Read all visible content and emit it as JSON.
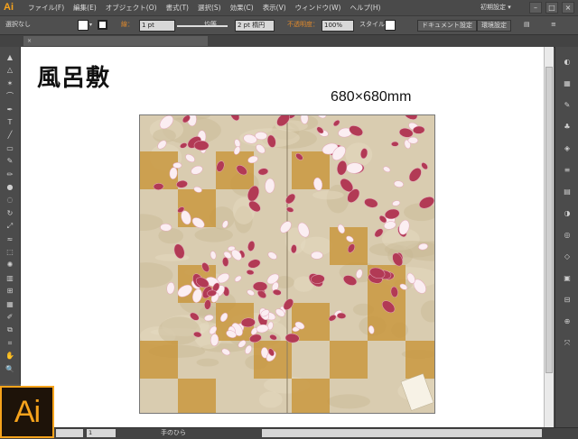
{
  "app": {
    "logo_text": "Ai",
    "workspace": "初期設定 ▾"
  },
  "menu": {
    "items": [
      "ファイル(F)",
      "編集(E)",
      "オブジェクト(O)",
      "書式(T)",
      "選択(S)",
      "効果(C)",
      "表示(V)",
      "ウィンドウ(W)",
      "ヘルプ(H)"
    ]
  },
  "control_bar": {
    "selection": "選択なし",
    "stroke_label": "線：",
    "stroke_weight": "1 pt",
    "stroke_profile": "均等",
    "brush": "2 pt 楕円",
    "opacity_label": "不透明度：",
    "opacity_value": "100%",
    "style_label": "スタイル：",
    "doc_settings_button": "ドキュメント設定",
    "prefs_button": "環境設定"
  },
  "document": {
    "artboard_title": "風呂敷",
    "artboard_size": "680×680mm"
  },
  "status": {
    "zoom": "",
    "page": "1",
    "tool_text": "手のひら"
  },
  "colors": {
    "accent": "#f7a31c",
    "furoshiki_bg": "#d9ccb0",
    "gold": "#c9983f",
    "petal_red": "#b23a55",
    "petal_white": "#fbeef2"
  },
  "icons": {
    "tools": [
      "selection-icon",
      "direct-selection-icon",
      "magic-wand-icon",
      "lasso-icon",
      "pen-icon",
      "type-icon",
      "line-icon",
      "rectangle-icon",
      "brush-icon",
      "pencil-icon",
      "blob-brush-icon",
      "eraser-icon",
      "rotate-icon",
      "scale-icon",
      "warp-icon",
      "free-transform-icon",
      "symbol-sprayer-icon",
      "graph-icon",
      "mesh-icon",
      "gradient-icon",
      "eyedropper-icon",
      "blend-icon",
      "slice-icon",
      "hand-icon",
      "zoom-icon"
    ],
    "panels": [
      "color-icon",
      "swatches-icon",
      "brushes-icon",
      "symbols-icon",
      "graphic-styles-icon",
      "stroke-icon",
      "gradient-panel-icon",
      "transparency-icon",
      "appearance-icon",
      "layers-icon",
      "artboards-icon",
      "align-icon",
      "pathfinder-icon",
      "transform-icon"
    ]
  }
}
